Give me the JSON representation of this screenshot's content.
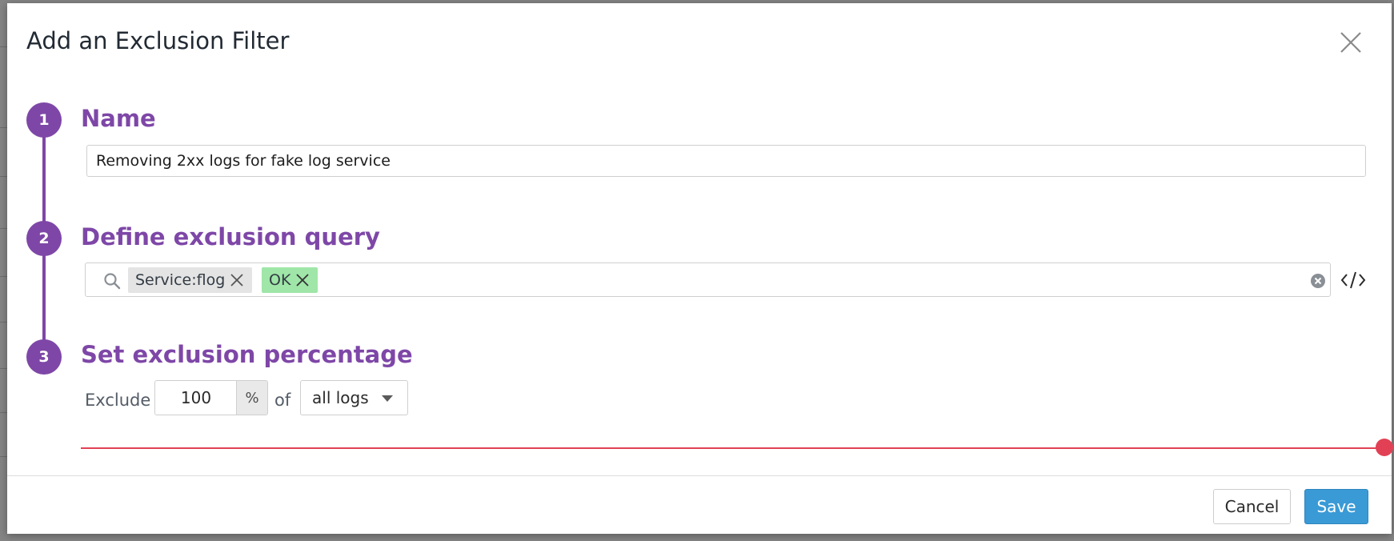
{
  "modal": {
    "title": "Add an Exclusion Filter"
  },
  "steps": [
    {
      "number": "1",
      "title": "Name"
    },
    {
      "number": "2",
      "title": "Define exclusion query"
    },
    {
      "number": "3",
      "title": "Set exclusion percentage"
    }
  ],
  "name_field": {
    "value": "Removing 2xx logs for fake log service"
  },
  "query": {
    "tags": [
      {
        "label": "Service:flog",
        "color": "#e4e4e4"
      },
      {
        "label": "OK",
        "color": "#9fe6a8"
      }
    ],
    "toggle_label": "</>"
  },
  "exclusion": {
    "prefix": "Exclude",
    "percent_value": "100",
    "percent_suffix": "%",
    "of_label": "of",
    "scope_selected": "all logs",
    "slider_fraction": 1.0
  },
  "buttons": {
    "cancel": "Cancel",
    "save": "Save"
  },
  "colors": {
    "step_accent": "#7e47a7",
    "slider": "#e24155",
    "primary_button": "#3a9ad6"
  },
  "icons": {
    "close": "close-icon",
    "search": "search-icon",
    "clear": "clear-icon",
    "tag_remove": "x-icon",
    "code": "code-icon",
    "dropdown": "caret-down-icon"
  }
}
